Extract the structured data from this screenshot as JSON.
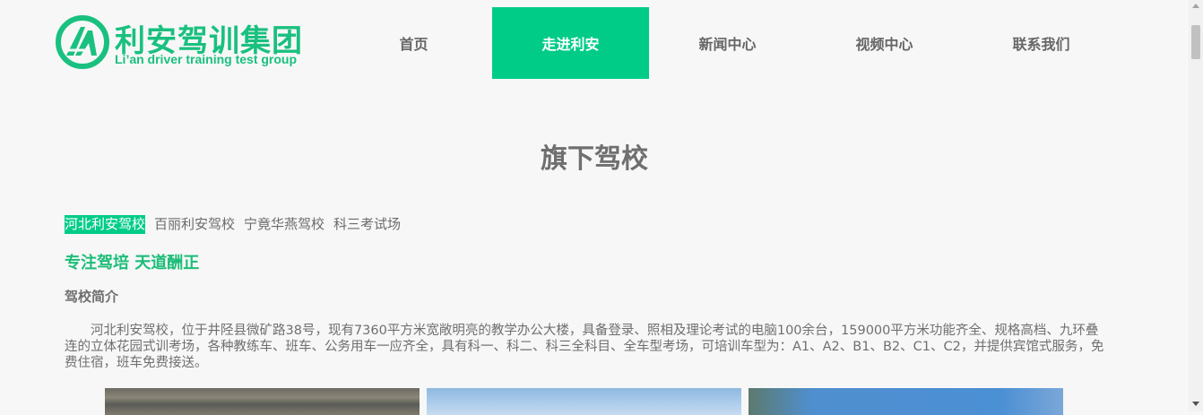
{
  "logo": {
    "cn": "利安驾训集团",
    "en": "Li’an driver training test group"
  },
  "nav": [
    {
      "label": "首页"
    },
    {
      "label": "走进利安"
    },
    {
      "label": "新闻中心"
    },
    {
      "label": "视频中心"
    },
    {
      "label": "联系我们"
    }
  ],
  "section": {
    "title": "旗下驾校"
  },
  "tabs": [
    {
      "label": "河北利安驾校"
    },
    {
      "label": "百丽利安驾校"
    },
    {
      "label": "宁竟华燕驾校"
    },
    {
      "label": "科三考试场"
    }
  ],
  "content": {
    "slogan": "专注驾培 天道酬正",
    "intro_heading": "驾校简介",
    "intro_text": "河北利安驾校，位于井陉县微矿路38号，现有7360平方米宽敞明亮的教学办公大楼，具备登录、照相及理论考试的电脑100余台，159000平方米功能齐全、规格高档、九环叠连的立体花园式训考场，各种教练车、班车、公务用车一应齐全，具有科一、科二、科三全科目、全车型考场，可培训车型为：A1、A2、B1、B2、C1、C2，并提供宾馆式服务，免费住宿，班车免费接送。"
  },
  "colors": {
    "accent": "#00cc88",
    "logo": "#19c07f"
  }
}
